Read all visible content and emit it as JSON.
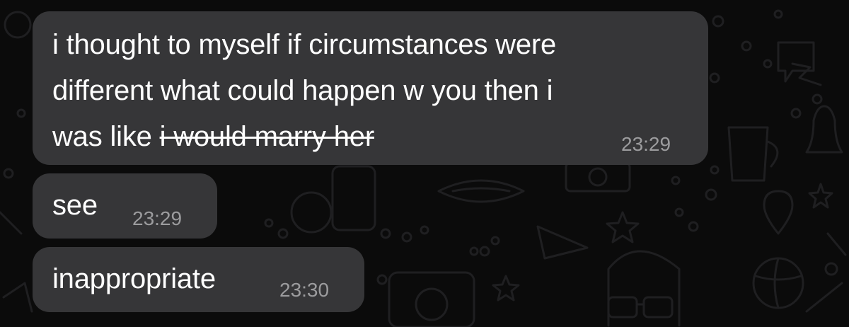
{
  "messages": [
    {
      "lines": [
        "i thought to myself if circumstances were",
        "different what could happen w you then i"
      ],
      "last_line_prefix": "was like ",
      "last_line_strikethrough": "i would marry her",
      "time": "23:29"
    },
    {
      "text": "see",
      "time": "23:29"
    },
    {
      "text": "inappropriate",
      "time": "23:30"
    }
  ],
  "colors": {
    "background": "#0b0b0b",
    "bubble": "#363638",
    "text": "#ffffff",
    "timestamp": "#9c9c9e",
    "doodle": "#1e1e20"
  },
  "wallpaper_icons": [
    "doodle-pattern-icon"
  ]
}
